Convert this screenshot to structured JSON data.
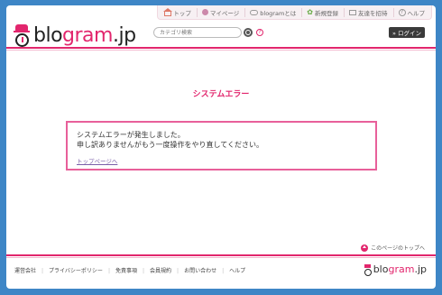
{
  "header": {
    "nav": [
      {
        "label": "トップ",
        "icon": "home-icon"
      },
      {
        "label": "マイページ",
        "icon": "mypage-icon"
      },
      {
        "label": "blogramとは",
        "icon": "speech-bubble-icon"
      },
      {
        "label": "新規登録",
        "icon": "sprout-icon"
      },
      {
        "label": "友達を招待",
        "icon": "mail-icon"
      },
      {
        "label": "ヘルプ",
        "icon": "help-icon"
      }
    ],
    "logo": {
      "part1": "blo",
      "part2": "gram",
      "part3": ".jp"
    },
    "search": {
      "placeholder": "カテゴリ検索",
      "help": "?"
    },
    "login_label": "» ログイン"
  },
  "main": {
    "error_title": "システムエラー",
    "error_line1": "システムエラーが発生しました。",
    "error_line2": "申し訳ありませんがもう一度操作をやり直してください。",
    "top_link": "トップページへ"
  },
  "to_top_label": "このページのトップへ",
  "footer": {
    "links": [
      "運営会社",
      "プライバシーポリシー",
      "免責事項",
      "会員規約",
      "お問い合わせ",
      "ヘルプ"
    ],
    "logo": {
      "part1": "blo",
      "part2": "gram",
      "part3": ".jp"
    }
  },
  "colors": {
    "accent": "#e2266d",
    "frame": "#3e86c6",
    "link": "#7a5fa8"
  }
}
